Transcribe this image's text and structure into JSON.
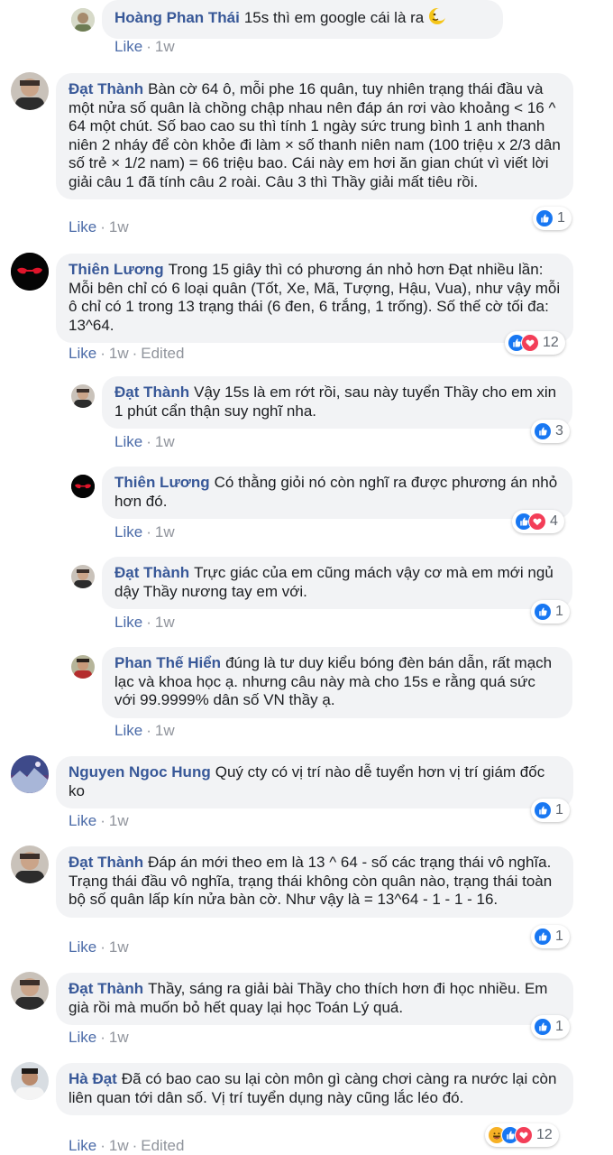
{
  "comments": [
    {
      "author": "Hoàng Phan Thái",
      "text": "15s thì em google cái là ra",
      "like": "Like",
      "time": "1w",
      "emoji": "moon-face"
    },
    {
      "author": "Đạt Thành",
      "text": "Bàn cờ 64 ô, mỗi phe 16 quân, tuy nhiên trạng thái đầu và một nửa số quân là chồng chập nhau nên đáp án rơi vào khoảng < 16 ^ 64 một chút. Số bao cao su thì tính 1 ngày sức trung bình 1 anh thanh niên 2 nháy để còn khỏe đi làm × số thanh niên nam (100 triệu x 2/3 dân số trẻ × 1/2 nam) = 66 triệu bao. Cái này em hơi ăn gian chút vì viết lời giải câu 1 đã tính câu 2 roài. Câu 3 thì Thầy giải mất tiêu rồi.",
      "like": "Like",
      "time": "1w",
      "reactions": "1"
    },
    {
      "author": "Thiên Lương",
      "text": "Trong 15 giây thì có phương án nhỏ hơn Đạt nhiều lần: Mỗi bên chỉ có 6 loại quân (Tốt, Xe, Mã, Tượng, Hậu, Vua), như vậy mỗi ô chỉ có 1 trong 13 trạng thái (6 đen, 6 trắng, 1 trống). Số thế cờ tối đa: 13^64.",
      "like": "Like",
      "time": "1w",
      "edited": "Edited",
      "reactions": "12"
    },
    {
      "author": "Đạt Thành",
      "text": "Vậy 15s là em rớt rồi, sau này tuyển Thầy cho em xin 1 phút cẩn thận suy nghĩ nha.",
      "like": "Like",
      "time": "1w",
      "reactions": "3"
    },
    {
      "author": "Thiên Lương",
      "text": "Có thằng giỏi nó còn nghĩ ra được phương án nhỏ hơn đó.",
      "like": "Like",
      "time": "1w",
      "reactions": "4"
    },
    {
      "author": "Đạt Thành",
      "text": "Trực giác của em cũng mách vậy cơ mà em mới ngủ dậy Thầy nương tay em với.",
      "like": "Like",
      "time": "1w",
      "reactions": "1"
    },
    {
      "author": "Phan Thế Hiển",
      "text": "đúng là tư duy kiểu bóng đèn bán dẫn, rất mạch lạc và khoa học ạ. nhưng câu này mà cho 15s e rằng quá sức với 99.9999% dân số VN thầy ạ.",
      "like": "Like",
      "time": "1w"
    },
    {
      "author": "Nguyen Ngoc Hung",
      "text": "Quý cty có vị trí nào dễ tuyển hơn vị trí giám đốc ko",
      "like": "Like",
      "time": "1w",
      "reactions": "1"
    },
    {
      "author": "Đạt Thành",
      "text": "Đáp án mới theo em là 13 ^ 64 - số các trạng thái vô nghĩa. Trạng thái đầu vô nghĩa, trạng thái không còn quân nào, trạng thái toàn bộ số quân lấp kín nửa bàn cờ. Như vậy là = 13^64 - 1 - 1 - 16.",
      "like": "Like",
      "time": "1w",
      "reactions": "1"
    },
    {
      "author": "Đạt Thành",
      "text": "Thầy, sáng ra giải bài Thầy cho thích hơn đi học nhiều. Em già rồi mà muốn bỏ hết quay lại học Toán Lý quá.",
      "like": "Like",
      "time": "1w",
      "reactions": "1"
    },
    {
      "author": "Hà Đạt",
      "text": "Đã có bao cao su lại còn môn gì càng chơi càng ra nước lại còn liên quan tới dân số. Vị trí tuyển dụng này cũng lắc léo đó.",
      "like": "Like",
      "time": "1w",
      "edited": "Edited",
      "reactions": "12"
    }
  ],
  "colors": {
    "author": "#385898",
    "like": "#4b6ba8",
    "meta": "#90949c",
    "bubble": "#f2f3f5",
    "like_icon": "#1877f2",
    "love_icon": "#f33e58",
    "haha_icon": "#f7b125"
  }
}
